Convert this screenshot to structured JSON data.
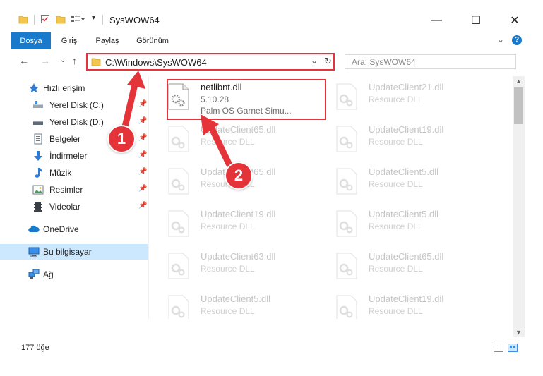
{
  "window": {
    "title": "SysWOW64",
    "minimize_glyph": "—",
    "maximize_glyph": "☐",
    "close_glyph": "✕"
  },
  "ribbon": {
    "tabs": [
      {
        "label": "Dosya",
        "active": true
      },
      {
        "label": "Giriş"
      },
      {
        "label": "Paylaş"
      },
      {
        "label": "Görünüm"
      }
    ],
    "help_glyph": "?"
  },
  "address": {
    "path": "C:\\Windows\\SysWOW64",
    "search_placeholder": "Ara: SysWOW64"
  },
  "navpane": {
    "quick_access": "Hızlı erişim",
    "items": [
      {
        "label": "Yerel Disk (C:)",
        "icon": "drive-icon",
        "pinned": true
      },
      {
        "label": "Yerel Disk (D:)",
        "icon": "drive-icon",
        "pinned": true
      },
      {
        "label": "Belgeler",
        "icon": "documents-icon",
        "pinned": true
      },
      {
        "label": "İndirmeler",
        "icon": "downloads-icon",
        "pinned": true
      },
      {
        "label": "Müzik",
        "icon": "music-icon",
        "pinned": true
      },
      {
        "label": "Resimler",
        "icon": "pictures-icon",
        "pinned": true
      },
      {
        "label": "Videolar",
        "icon": "videos-icon",
        "pinned": true
      }
    ],
    "onedrive": "OneDrive",
    "this_pc": "Bu bilgisayar",
    "network": "Ağ"
  },
  "files": {
    "highlighted": {
      "name": "netlibnt.dll",
      "version": "5.10.28",
      "description": "Palm OS Garnet Simu..."
    },
    "column_left": [
      {
        "name": "UpdateClient65.dll",
        "description": "Resource DLL"
      },
      {
        "name": "UpdateClient65.dll",
        "description": "Resource DLL"
      },
      {
        "name": "UpdateClient19.dll",
        "description": "Resource DLL"
      },
      {
        "name": "UpdateClient63.dll",
        "description": "Resource DLL"
      },
      {
        "name": "UpdateClient5.dll",
        "description": "Resource DLL"
      }
    ],
    "column_right": [
      {
        "name": "UpdateClient21.dll",
        "description": "Resource DLL"
      },
      {
        "name": "UpdateClient19.dll",
        "description": "Resource DLL"
      },
      {
        "name": "UpdateClient5.dll",
        "description": "Resource DLL"
      },
      {
        "name": "UpdateClient5.dll",
        "description": "Resource DLL"
      },
      {
        "name": "UpdateClient65.dll",
        "description": "Resource DLL"
      },
      {
        "name": "UpdateClient19.dll",
        "description": "Resource DLL"
      }
    ]
  },
  "status": {
    "item_count": "177 öğe"
  },
  "callouts": [
    {
      "number": "1"
    },
    {
      "number": "2"
    }
  ],
  "colors": {
    "accent": "#1979ca",
    "highlight": "#e4343a",
    "selected": "#cce8ff"
  }
}
